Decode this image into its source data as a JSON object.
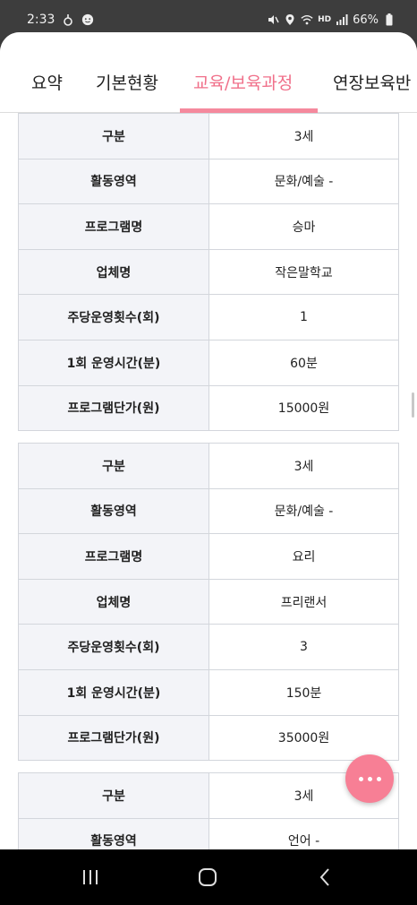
{
  "status": {
    "time": "2:33",
    "battery": "66%",
    "hd": "HD"
  },
  "tabs": [
    {
      "label": "요약"
    },
    {
      "label": "기본현황"
    },
    {
      "label": "교육/보육과정"
    },
    {
      "label": "연장보육반"
    }
  ],
  "programs": [
    {
      "rows": [
        {
          "label": "구분",
          "value": "3세"
        },
        {
          "label": "활동영역",
          "value": "문화/예술 -"
        },
        {
          "label": "프로그램명",
          "value": "승마"
        },
        {
          "label": "업체명",
          "value": "작은말학교"
        },
        {
          "label": "주당운영횟수(회)",
          "value": "1"
        },
        {
          "label": "1회 운영시간(분)",
          "value": "60분"
        },
        {
          "label": "프로그램단가(원)",
          "value": "15000원"
        }
      ]
    },
    {
      "rows": [
        {
          "label": "구분",
          "value": "3세"
        },
        {
          "label": "활동영역",
          "value": "문화/예술 -"
        },
        {
          "label": "프로그램명",
          "value": "요리"
        },
        {
          "label": "업체명",
          "value": "프리랜서"
        },
        {
          "label": "주당운영횟수(회)",
          "value": "3"
        },
        {
          "label": "1회 운영시간(분)",
          "value": "150분"
        },
        {
          "label": "프로그램단가(원)",
          "value": "35000원"
        }
      ]
    },
    {
      "rows": [
        {
          "label": "구분",
          "value": "3세"
        },
        {
          "label": "활동영역",
          "value": "언어 -"
        }
      ]
    }
  ],
  "fab": {
    "icon": "more-dots-icon",
    "color": "#f77f95"
  },
  "accent_color": "#f0708a"
}
